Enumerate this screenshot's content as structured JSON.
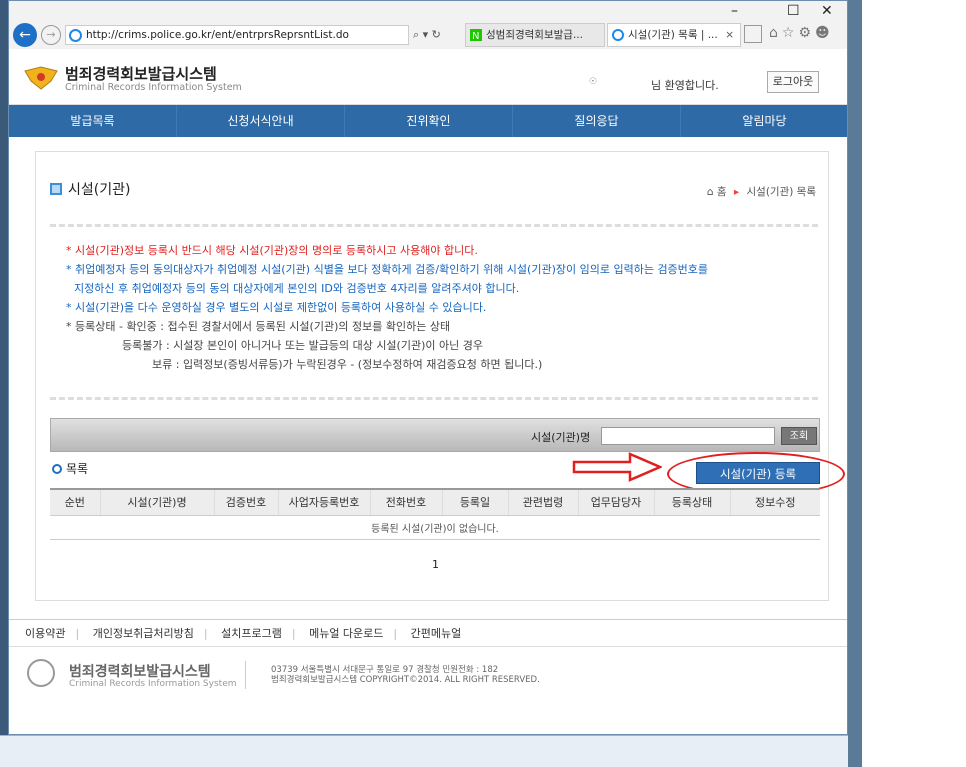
{
  "browser": {
    "url": "http://crims.police.go.kr/ent/entrprsReprsntList.do",
    "addr_tools": "⌕ ▾ ↻",
    "tabs": [
      {
        "label": "성범죄경력회보발급..."
      },
      {
        "label": "시설(기관) 목록 | ..."
      }
    ],
    "tab_close": "×",
    "window_controls": [
      "–",
      "☐",
      "✕"
    ]
  },
  "header": {
    "title": "범죄경력회보발급시스템",
    "subtitle": "Criminal Records Information System",
    "welcome": "님 환영합니다.",
    "logout": "로그아웃"
  },
  "nav": [
    "발급목록",
    "신청서식안내",
    "진위확인",
    "질의응답",
    "알림마당"
  ],
  "page": {
    "title": "시설(기관)",
    "breadcrumb_home": "홈",
    "breadcrumb_current": "시설(기관) 목록"
  },
  "notices": {
    "n1": "* 시설(기관)정보 등록시 반드시 해당 시설(기관)장의 명의로 등록하시고 사용해야 합니다.",
    "n2": "* 취업예정자 등의 동의대상자가 취업예정 시설(기관) 식별을 보다 정확하게 검증/확인하기 위해 시설(기관)장이 임의로 입력하는 검증번호를",
    "n3": "지정하신 후 취업예정자 등의 동의 대상자에게 본인의 ID와 검증번호 4자리를 알려주셔야 합니다.",
    "n4": "* 시설(기관)을 다수 운영하실 경우 별도의 시설로 제한없이 등록하여 사용하실 수 있습니다.",
    "n5": "* 등록상태 - 확인중 : 접수된 경찰서에서 등록된 시설(기관)의 정보를 확인하는 상태",
    "n6": "등록불가 : 시설장 본인이 아니거나 또는 발급등의 대상 시설(기관)이 아닌 경우",
    "n7": "보류 : 입력정보(증빙서류등)가 누락된경우 - (정보수정하여 재검증요청 하면 됩니다.)"
  },
  "search": {
    "label": "시설(기관)명",
    "value": "",
    "button": "조회"
  },
  "list": {
    "label": "목록",
    "register_button": "시설(기관) 등록",
    "columns": [
      "순번",
      "시설(기관)명",
      "검증번호",
      "사업자등록번호",
      "전화번호",
      "등록일",
      "관련법령",
      "업무담당자",
      "등록상태",
      "정보수정"
    ],
    "empty_message": "등록된 시설(기관)이 없습니다.",
    "page": "1"
  },
  "footer": {
    "links": [
      "이용약관",
      "개인정보취급처리방침",
      "설치프로그램",
      "메뉴얼 다운로드",
      "간편메뉴얼"
    ],
    "title": "범죄경력회보발급시스템",
    "subtitle": "Criminal Records Information System",
    "address": "03739  서울특별시 서대문구 통일로 97 경찰청    민원전화 : 182",
    "copyright": "범죄경력회보발급시스템 COPYRIGHT©2014. ALL RIGHT RESERVED."
  },
  "colors": {
    "nav_bg": "#2d6aa6",
    "register_btn": "#2f6fb6",
    "highlight_red": "#e02020",
    "notice_blue": "#1565c0"
  }
}
